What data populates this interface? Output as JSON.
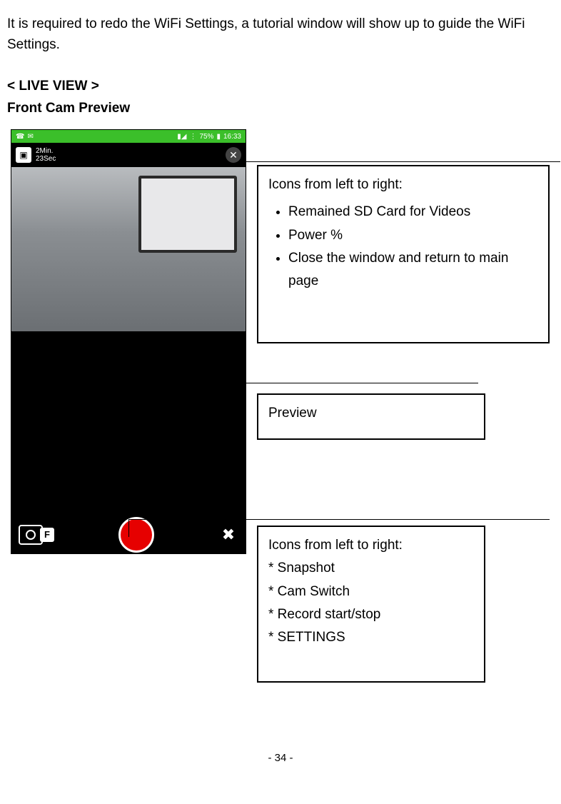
{
  "intro": "It is required to redo the WiFi Settings, a tutorial window will show up to guide the WiFi Settings.",
  "section": "< LIVE VIEW >",
  "subsection": "Front Cam Preview",
  "statusbar": {
    "battery": "75%",
    "time": "16:33"
  },
  "topbar": {
    "sd_line1": "2Min.",
    "sd_line2": "23Sec"
  },
  "bottombar": {
    "f_label": "F"
  },
  "annot1": {
    "title": "Icons from left to right:",
    "items": [
      "Remained SD Card for Videos",
      "Power %",
      "Close the window and return to main page"
    ]
  },
  "annot2": {
    "title": "Preview"
  },
  "annot3": {
    "title": "Icons from left to right:",
    "items": [
      "* Snapshot",
      "* Cam Switch",
      "* Record start/stop",
      "* SETTINGS"
    ]
  },
  "page_number": "- 34 -"
}
